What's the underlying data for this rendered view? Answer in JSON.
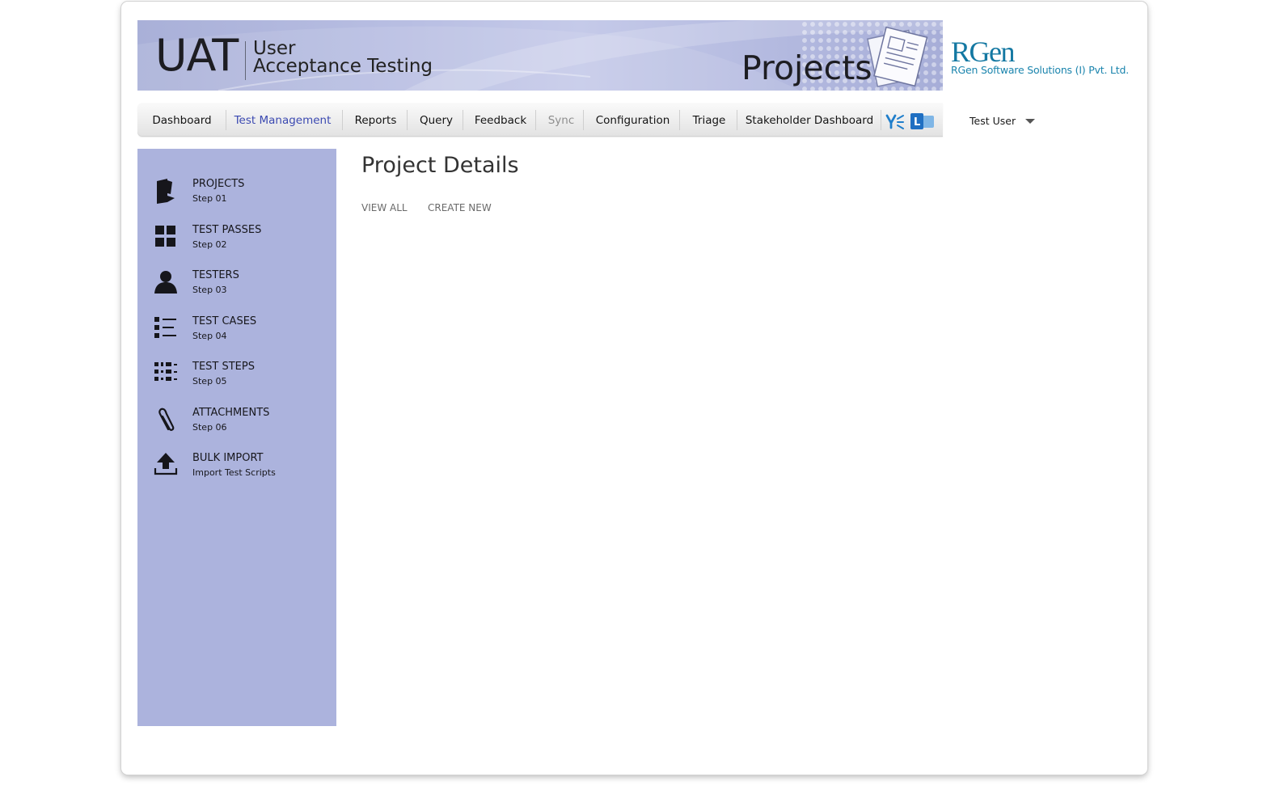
{
  "banner": {
    "app_abbrev": "UAT",
    "app_line1": "User",
    "app_line2": "Acceptance Testing",
    "section_title": "Projects"
  },
  "company": {
    "logo_text": "RGen",
    "name": "RGen Software Solutions (I) Pvt. Ltd."
  },
  "nav": {
    "items": [
      {
        "label": "Dashboard"
      },
      {
        "label": "Test Management"
      },
      {
        "label": "Reports"
      },
      {
        "label": "Query"
      },
      {
        "label": "Feedback"
      },
      {
        "label": "Sync"
      },
      {
        "label": "Configuration"
      },
      {
        "label": "Triage"
      },
      {
        "label": "Stakeholder Dashboard"
      }
    ],
    "active": "Test Management",
    "disabled": "Sync",
    "icons": [
      "yammer-icon",
      "lync-icon"
    ]
  },
  "user": {
    "name": "Test User"
  },
  "sidebar": {
    "items": [
      {
        "title": "PROJECTS",
        "sub": "Step 01",
        "icon": "folder-icon"
      },
      {
        "title": "TEST PASSES",
        "sub": "Step 02",
        "icon": "grid-icon"
      },
      {
        "title": "TESTERS",
        "sub": "Step 03",
        "icon": "user-icon"
      },
      {
        "title": "TEST CASES",
        "sub": "Step 04",
        "icon": "list-icon"
      },
      {
        "title": "TEST STEPS",
        "sub": "Step 05",
        "icon": "steps-icon"
      },
      {
        "title": "ATTACHMENTS",
        "sub": "Step 06",
        "icon": "paperclip-icon"
      },
      {
        "title": "BULK IMPORT",
        "sub": "Import Test Scripts",
        "icon": "upload-icon"
      }
    ]
  },
  "content": {
    "title": "Project Details",
    "links": [
      {
        "label": "VIEW ALL"
      },
      {
        "label": "CREATE NEW"
      }
    ]
  },
  "colors": {
    "sidebar_bg": "#acb3dd",
    "banner_bg": "#b9bfe3",
    "active_nav": "#3b49b1",
    "logo": "#1478a2"
  }
}
